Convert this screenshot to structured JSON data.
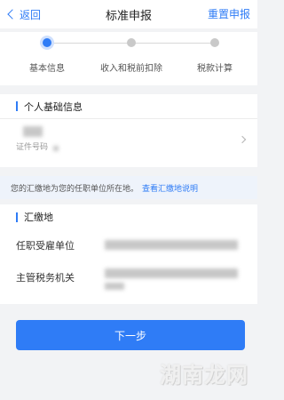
{
  "nav": {
    "back_label": "返回",
    "title": "标准申报",
    "reset_label": "重置申报"
  },
  "steps": [
    {
      "label": "基本信息",
      "active": true
    },
    {
      "label": "收入和税前扣除",
      "active": false
    },
    {
      "label": "税款计算",
      "active": false
    }
  ],
  "personal_section": {
    "title": "个人基础信息",
    "id_label": "证件号码"
  },
  "notice": {
    "text": "您的汇缴地为您的任职单位所在地。",
    "link": "查看汇缴地说明"
  },
  "remit_section": {
    "title": "汇缴地",
    "fields": [
      {
        "label": "任职受雇单位"
      },
      {
        "label": "主管税务机关"
      }
    ]
  },
  "next_button": "下一步",
  "watermark": "湖南龙网",
  "colors": {
    "accent": "#2f7cf6",
    "background": "#f2f3f5",
    "notice_bg": "#eef3fb"
  }
}
